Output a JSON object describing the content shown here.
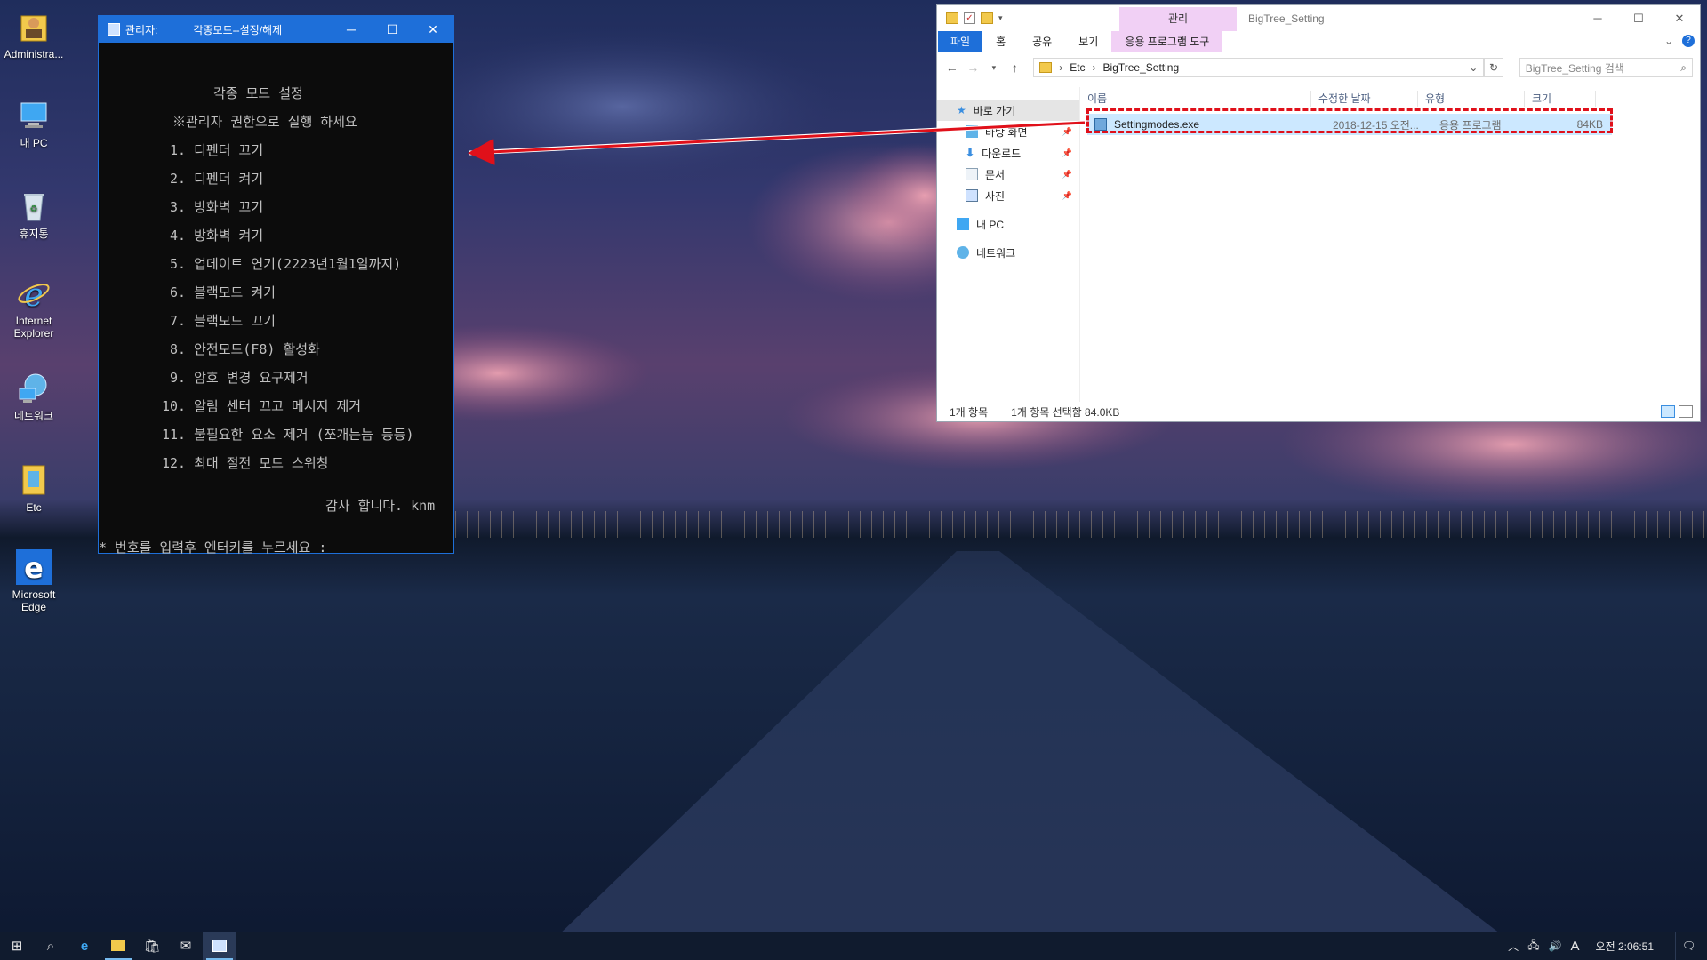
{
  "desktop": {
    "icons": [
      {
        "label": "Administra...",
        "icon": "user-folder-icon"
      },
      {
        "label": "내 PC",
        "icon": "computer-icon"
      },
      {
        "label": "휴지통",
        "icon": "recycle-bin-icon"
      },
      {
        "label": "Internet Explorer",
        "icon": "internet-explorer-icon"
      },
      {
        "label": "네트워크",
        "icon": "network-icon"
      },
      {
        "label": "Etc",
        "icon": "folder-icon"
      },
      {
        "label": "Microsoft Edge",
        "icon": "edge-icon"
      }
    ]
  },
  "console": {
    "title_prefix": "관리자:",
    "title": "각종모드--설정/해제",
    "controls": {
      "minimize": "─",
      "maximize": "☐",
      "close": "✕"
    },
    "heading": "각종 모드 설정",
    "notice": "※관리자 권한으로 실행 하세요",
    "menu": [
      "1. 디펜더 끄기",
      "2. 디펜더 켜기",
      "3. 방화벽 끄기",
      "4. 방화벽 켜기",
      "5. 업데이트 연기(2223년1월1일까지)",
      "6. 블랙모드 켜기",
      "7. 블랙모드 끄기",
      "8. 안전모드(F8) 활성화",
      "9. 암호 변경 요구제거",
      "10. 알림 센터 끄고 메시지 제거",
      "11. 불필요한 요소 제거 (쪼개는늠 등등)",
      "12. 최대 절전 모드 스위칭"
    ],
    "thanks": "감사 합니다. knm",
    "prompt": "* 번호를 입력후 엔터키를 누르세요 :"
  },
  "explorer": {
    "title": "BigTree_Setting",
    "contextual_tab_group": "관리",
    "tabs": [
      "파일",
      "홈",
      "공유",
      "보기",
      "응용 프로그램 도구"
    ],
    "breadcrumb": [
      "Etc",
      "BigTree_Setting"
    ],
    "search_placeholder": "BigTree_Setting 검색",
    "nav": [
      {
        "label": "바로 가기",
        "selected": true,
        "pinned": false
      },
      {
        "label": "바탕 화면",
        "selected": false,
        "pinned": true
      },
      {
        "label": "다운로드",
        "selected": false,
        "pinned": true
      },
      {
        "label": "문서",
        "selected": false,
        "pinned": true
      },
      {
        "label": "사진",
        "selected": false,
        "pinned": true
      },
      {
        "label": "내 PC",
        "selected": false,
        "pinned": false
      },
      {
        "label": "네트워크",
        "selected": false,
        "pinned": false
      }
    ],
    "columns": [
      "이름",
      "수정한 날짜",
      "유형",
      "크기"
    ],
    "files": [
      {
        "name": "Settingmodes.exe",
        "modified": "2018-12-15 오전...",
        "type": "응용 프로그램",
        "size": "84KB",
        "selected": true
      }
    ],
    "status_count": "1개 항목",
    "status_selection": "1개 항목 선택함 84.0KB",
    "colors": {
      "accent": "#1e6fd9",
      "contextual": "#f1d0f5",
      "selection": "#cce8ff"
    }
  },
  "annotation": {
    "highlight_color": "#e0101a",
    "arrow_color": "#e0101a"
  },
  "taskbar": {
    "buttons": [
      "start-icon",
      "search-icon",
      "edge-icon",
      "file-explorer-icon",
      "store-icon",
      "mail-icon",
      "console-app-icon"
    ],
    "tray": {
      "ime": "A",
      "time": "오전 2:06:51"
    }
  }
}
